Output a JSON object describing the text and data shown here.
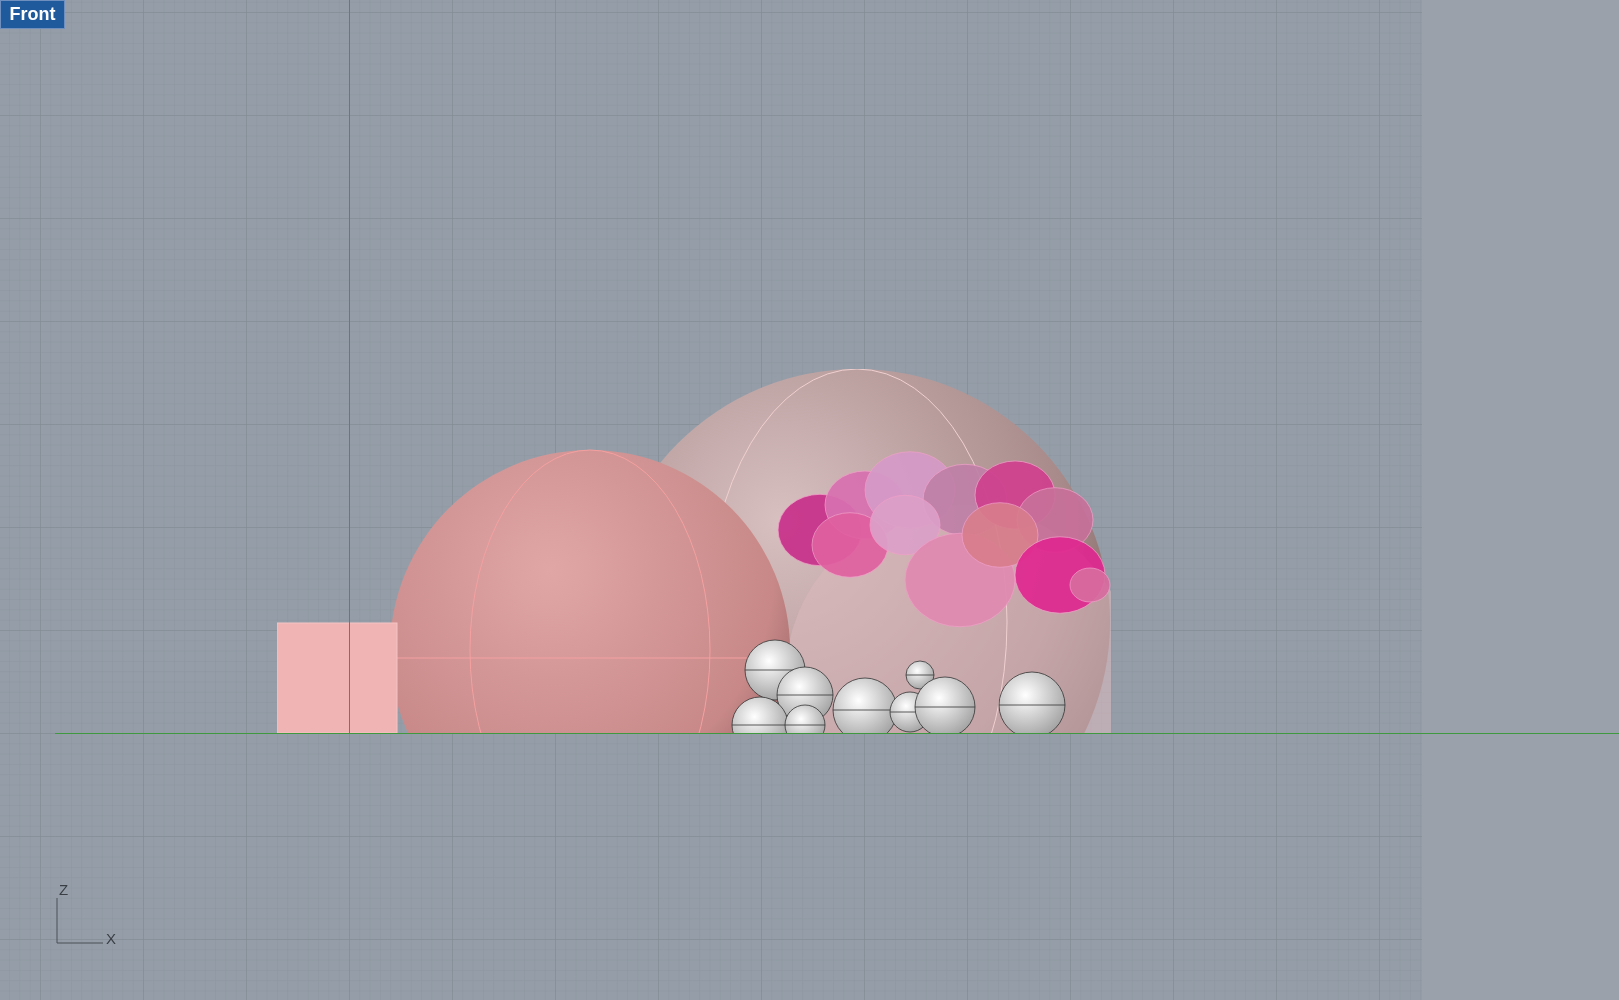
{
  "viewport": {
    "label": "Front"
  },
  "axis_indicator": {
    "vertical_label": "Z",
    "horizontal_label": "X"
  }
}
